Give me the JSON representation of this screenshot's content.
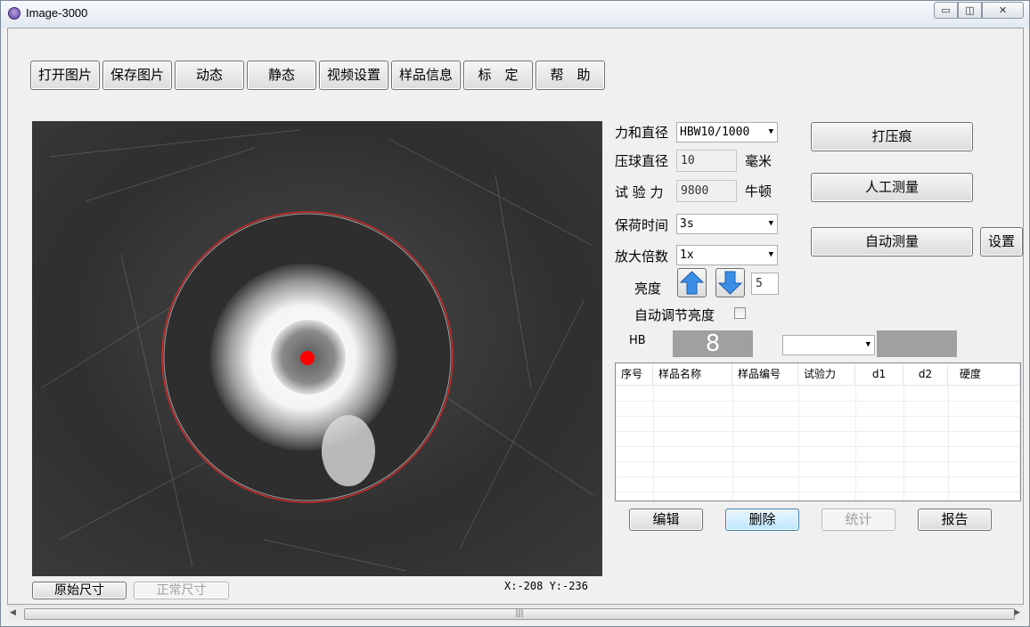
{
  "window": {
    "title": "Image-3000",
    "min_glyph": "▭",
    "max_glyph": "◫",
    "close_glyph": "✕",
    "icon": "app-eye-icon"
  },
  "toolbar": {
    "open_image": "打开图片",
    "save_image": "保存图片",
    "dynamic": "动态",
    "static": "静态",
    "video_settings": "视频设置",
    "sample_info": "样品信息",
    "calibrate": "标　定",
    "help": "帮　助"
  },
  "params": {
    "force_diameter_label": "力和直径",
    "force_diameter_value": "HBW10/1000",
    "ball_diameter_label": "压球直径",
    "ball_diameter_value": "10",
    "ball_diameter_unit": "毫米",
    "test_force_label": "试 验 力",
    "test_force_value": "9800",
    "test_force_unit": "牛顿",
    "dwell_time_label": "保荷时间",
    "dwell_time_value": "3s",
    "magnification_label": "放大倍数",
    "magnification_value": "1x",
    "brightness_label": "亮度",
    "brightness_value": "5",
    "auto_brightness_label": "自动调节亮度",
    "auto_brightness_checked": false,
    "hb_label": "HB",
    "hb_value": "8"
  },
  "actions": {
    "indent": "打压痕",
    "manual_measure": "人工测量",
    "auto_measure": "自动测量",
    "settings": "设置"
  },
  "table": {
    "columns": [
      "序号",
      "样品名称",
      "样品编号",
      "试验力",
      "d1",
      "d2",
      "硬度"
    ],
    "rows": []
  },
  "bottom_buttons": {
    "edit": "编辑",
    "delete": "删除",
    "statistics": "统计",
    "report": "报告"
  },
  "view_buttons": {
    "original_size": "原始尺寸",
    "normal_size": "正常尺寸"
  },
  "coords": {
    "text": "X:-208  Y:-236"
  },
  "scrollbar": {
    "left_arrow": "◀",
    "right_arrow": "▶",
    "grip": "|||"
  },
  "colors": {
    "circle": "#e03030",
    "center_dot": "#ff0000",
    "arrow_blue": "#3a8ee6"
  }
}
